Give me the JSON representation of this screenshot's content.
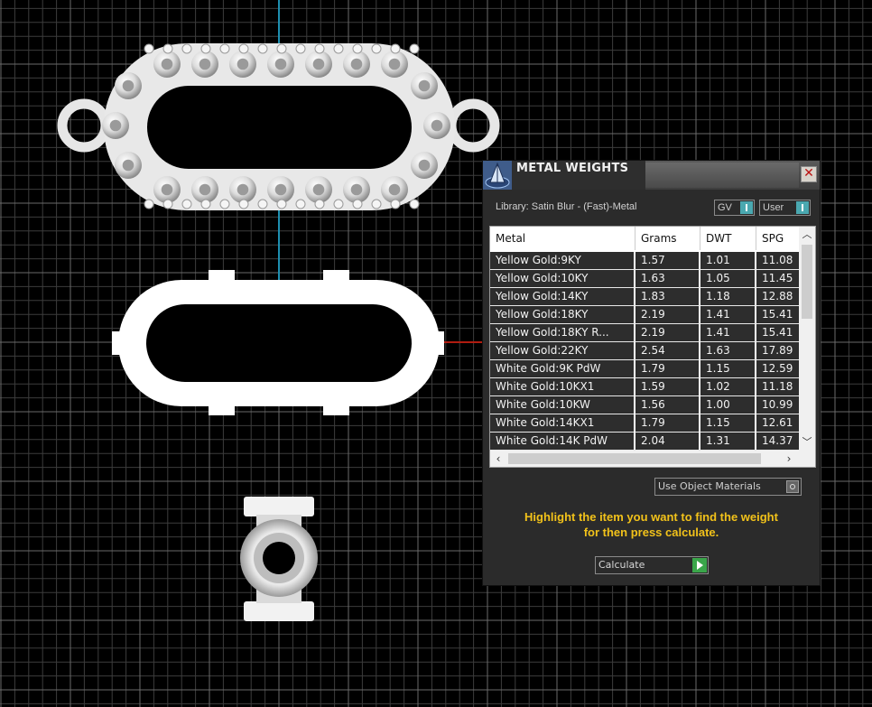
{
  "panel": {
    "title": "METAL WEIGHTS",
    "close_icon": "x-icon",
    "library_label": "Library: Satin Blur - (Fast)-Metal",
    "gv_label": "GV",
    "user_label": "User",
    "use_materials_label": "Use Object Materials",
    "instructions_line1": "Highlight the item you want to find the weight",
    "instructions_line2": "for then press calculate.",
    "calculate_label": "Calculate"
  },
  "table": {
    "headers": {
      "metal": "Metal",
      "grams": "Grams",
      "dwt": "DWT",
      "spg": "SPG"
    },
    "rows": [
      {
        "metal": "Yellow Gold:9KY",
        "grams": "1.57",
        "dwt": "1.01",
        "spg": "11.08"
      },
      {
        "metal": "Yellow Gold:10KY",
        "grams": "1.63",
        "dwt": "1.05",
        "spg": "11.45"
      },
      {
        "metal": "Yellow Gold:14KY",
        "grams": "1.83",
        "dwt": "1.18",
        "spg": "12.88"
      },
      {
        "metal": "Yellow Gold:18KY",
        "grams": "2.19",
        "dwt": "1.41",
        "spg": "15.41"
      },
      {
        "metal": "Yellow Gold:18KY R...",
        "grams": "2.19",
        "dwt": "1.41",
        "spg": "15.41"
      },
      {
        "metal": "Yellow Gold:22KY",
        "grams": "2.54",
        "dwt": "1.63",
        "spg": "17.89"
      },
      {
        "metal": "White Gold:9K PdW",
        "grams": "1.79",
        "dwt": "1.15",
        "spg": "12.59"
      },
      {
        "metal": "White Gold:10KX1",
        "grams": "1.59",
        "dwt": "1.02",
        "spg": "11.18"
      },
      {
        "metal": "White Gold:10KW",
        "grams": "1.56",
        "dwt": "1.00",
        "spg": "10.99"
      },
      {
        "metal": "White Gold:14KX1",
        "grams": "1.79",
        "dwt": "1.15",
        "spg": "12.61"
      },
      {
        "metal": "White Gold:14K PdW",
        "grams": "2.04",
        "dwt": "1.31",
        "spg": "14.37"
      }
    ]
  },
  "viewport": {
    "background": "#000000",
    "grid_color": "#4a4a4a",
    "axis_y_color": "#1e8fb0",
    "axis_x_color": "#b01c10",
    "objects": [
      "beaded-oval-link",
      "plain-oval-link",
      "tube-bail"
    ]
  }
}
